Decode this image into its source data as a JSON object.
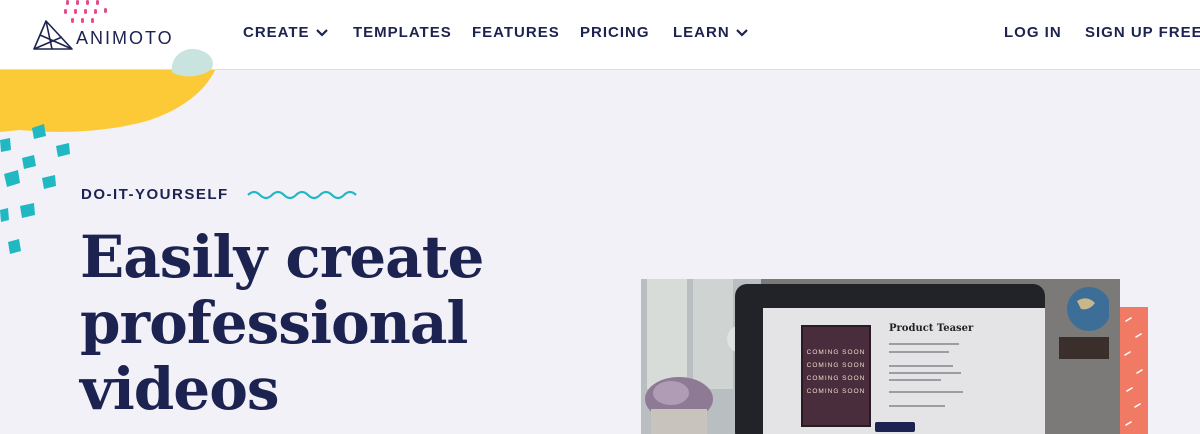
{
  "brand": {
    "name": "ANIMOTO"
  },
  "nav": {
    "items": [
      {
        "label": "CREATE",
        "has_dropdown": true
      },
      {
        "label": "TEMPLATES",
        "has_dropdown": false
      },
      {
        "label": "FEATURES",
        "has_dropdown": false
      },
      {
        "label": "PRICING",
        "has_dropdown": false
      },
      {
        "label": "LEARN",
        "has_dropdown": true
      }
    ],
    "login": "LOG IN",
    "signup": "SIGN UP FREE"
  },
  "hero": {
    "eyebrow": "DO-IT-YOURSELF",
    "headline_lines": [
      "Easily create",
      "professional",
      "videos"
    ]
  },
  "media": {
    "product_title": "Product Teaser",
    "poster_lines": [
      "COMING SOON",
      "COMING SOON",
      "COMING SOON",
      "COMING SOON"
    ]
  },
  "colors": {
    "navy": "#1d2350",
    "background": "#f2f1f7",
    "yellow": "#fcc937",
    "mint": "#c9e4df",
    "teal": "#1fb8c3",
    "pink": "#e8498b",
    "coral": "#f07a64"
  },
  "icons": [
    "animoto-logo-icon",
    "chevron-down-icon",
    "wave-icon"
  ]
}
